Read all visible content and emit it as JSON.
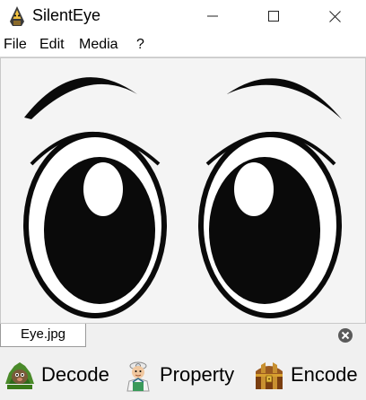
{
  "window": {
    "title": "SilentEye"
  },
  "menu": {
    "items": [
      "File",
      "Edit",
      "Media",
      "?"
    ]
  },
  "viewer": {
    "image_colors": {
      "background": "#f4f4f4",
      "ink": "#0a0a0a",
      "highlight": "#ffffff"
    }
  },
  "tabs": [
    {
      "label": "Eye.jpg"
    }
  ],
  "actions": {
    "decode": "Decode",
    "property": "Property",
    "encode": "Encode"
  },
  "icons": {
    "app": "hooded-figure-icon",
    "minimize": "minimize-icon",
    "maximize": "maximize-icon",
    "close": "close-icon",
    "tab_close": "tab-close-icon",
    "decode": "decode-mole-icon",
    "property": "property-doctor-icon",
    "encode": "encode-treasure-chest-icon"
  }
}
